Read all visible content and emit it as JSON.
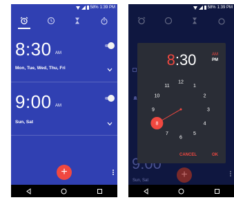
{
  "left_screen": {
    "status": {
      "battery": "58%",
      "time": "1:39 PM"
    },
    "tabs": [
      {
        "icon": "alarm-clock-icon",
        "selected": true
      },
      {
        "icon": "clock-icon",
        "selected": false
      },
      {
        "icon": "timer-icon",
        "selected": false
      },
      {
        "icon": "stopwatch-icon",
        "selected": false
      }
    ],
    "alarms": [
      {
        "time": "8:30",
        "period": "AM",
        "days": "Mon, Tue, Wed, Thu, Fri",
        "enabled": false
      },
      {
        "time": "9:00",
        "period": "AM",
        "days": "Sun, Sat",
        "enabled": false
      }
    ],
    "fab_label": "+"
  },
  "right_screen": {
    "status": {
      "battery": "58%",
      "time": "1:39 PM"
    },
    "background_alarm": {
      "time": "9:00",
      "days": "Sun, Sat"
    },
    "time_picker": {
      "hour": "8",
      "separator": ":",
      "minute": "30",
      "am_label": "AM",
      "pm_label": "PM",
      "clock_numbers": [
        "12",
        "1",
        "2",
        "3",
        "4",
        "5",
        "6",
        "7",
        "8",
        "9",
        "10",
        "11"
      ],
      "selected_hour": "8",
      "cancel_label": "CANCEL",
      "ok_label": "OK"
    },
    "fab_label": "+"
  },
  "colors": {
    "primary": "#3040b2",
    "accent": "#f04840",
    "dialog": "#2a2d36"
  }
}
